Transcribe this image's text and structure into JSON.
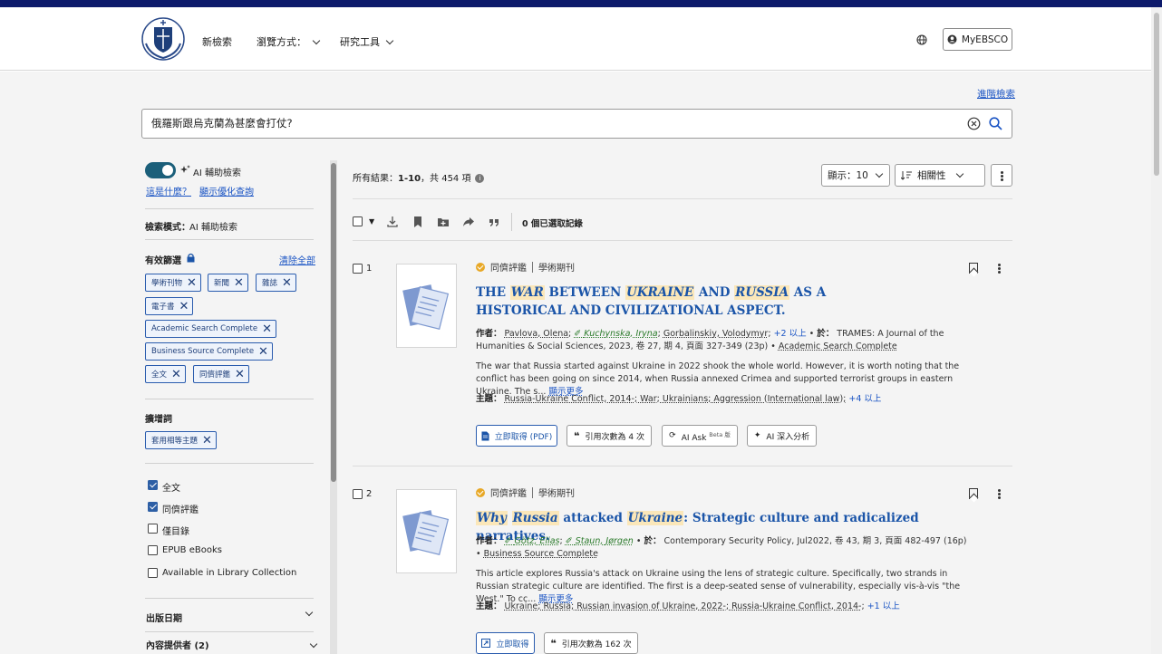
{
  "header": {
    "nav": [
      {
        "label": "新檢索"
      },
      {
        "label": "瀏覽方式："
      },
      {
        "label": "研究工具"
      }
    ],
    "myebsco": "MyEBSCO"
  },
  "search": {
    "advanced_link": "進階檢索",
    "query": "俄羅斯跟烏克蘭為甚麼會打仗?"
  },
  "sidebar": {
    "ai_label": "AI 輔助檢索",
    "what_is": "這是什麼？",
    "show_optimized": "顯示優化查詢",
    "mode_label": "檢索模式：",
    "mode_value": "AI 輔助檢索",
    "active_filters": "有效篩選",
    "clear_all": "清除全部",
    "filters": [
      "學術刊物",
      "新聞",
      "雜誌",
      "電子書",
      "Academic Search Complete",
      "Business Source Complete",
      "全文",
      "同儕評鑑"
    ],
    "expanders_title": "擴增詞",
    "expander_chip": "套用相等主題",
    "limiters": [
      {
        "label": "全文",
        "checked": true
      },
      {
        "label": "同儕評鑑",
        "checked": true
      },
      {
        "label": "僅目錄",
        "checked": false
      },
      {
        "label": "EPUB eBooks",
        "checked": false
      },
      {
        "label": "Available in Library Collection",
        "checked": false
      }
    ],
    "pub_date": "出版日期",
    "providers": "內容提供者 (2)"
  },
  "results": {
    "summary_prefix": "所有結果：",
    "summary_range": "1-10",
    "summary_suffix": "，共 454 項",
    "display_select": "顯示：10",
    "sort_select": "相關性",
    "selected_count": "0 個已選取記錄"
  },
  "records": [
    {
      "num": "1",
      "peer_review": "同儕評鑑",
      "type": "學術期刊",
      "title_parts": [
        {
          "t": "THE ",
          "h": false
        },
        {
          "t": "WAR",
          "h": true
        },
        {
          "t": " BETWEEN ",
          "h": false
        },
        {
          "t": "UKRAINE",
          "h": true
        },
        {
          "t": " AND ",
          "h": false
        },
        {
          "t": "RUSSIA",
          "h": true
        },
        {
          "t": " AS A HISTORICAL AND CIVILIZATIONAL ASPECT.",
          "h": false
        }
      ],
      "authors_label": "作者：",
      "author1": "Pavlova, Olena",
      "author2": "Kuchynska, Iryna",
      "author3": "Gorbalinskiy, Volodymyr",
      "more_authors": "+2 以上",
      "in_label": "於：",
      "source": "TRAMES: A Journal of the Humanities & Social Sciences, 2023, 卷 27, 期 4, 頁面 327-349 (23p) •",
      "database": "Academic Search Complete",
      "abstract": "The war that Russia started against Ukraine in 2022 shook the whole world. However, it is worth noting that the conflict has been going on since 2014, when Russia annexed Crimea and supported terrorist groups in eastern Ukraine. The s...",
      "show_more": "顯示更多",
      "subjects_label": "主題：",
      "subjects": "Russia-Ukraine Conflict, 2014-; War; Ukrainians; Aggression (International law);",
      "more_subjects": "+4 以上",
      "btn_pdf": "立即取得 (PDF)",
      "btn_cite": "引用次數為 4 次",
      "btn_ask": "AI Ask",
      "btn_ask_sup": "Beta 版",
      "btn_deep": "AI 深入分析"
    },
    {
      "num": "2",
      "peer_review": "同儕評鑑",
      "type": "學術期刊",
      "title_parts": [
        {
          "t": "Why",
          "h": true
        },
        {
          "t": " ",
          "h": false
        },
        {
          "t": "Russia",
          "h": true
        },
        {
          "t": " attacked ",
          "h": false
        },
        {
          "t": "Ukraine",
          "h": true
        },
        {
          "t": ": Strategic culture and radicalized narratives.",
          "h": false
        }
      ],
      "authors_label": "作者：",
      "author1": "Götz, Elias",
      "author2": "Staun, Jørgen",
      "in_label": "於：",
      "source": "Contemporary Security Policy, Jul2022, 卷 43, 期 3, 頁面 482-497 (16p) •",
      "database": "Business Source Complete",
      "abstract": "This article explores Russia's attack on Ukraine using the lens of strategic culture. Specifically, two strands in Russian strategic culture are identified. The first is a deep-seated sense of vulnerability, especially vis-à-vis \"the West.\" To cc...",
      "show_more": "顯示更多",
      "subjects_label": "主題：",
      "subjects": "Ukraine; Russia; Russian invasion of Ukraine, 2022-; Russia-Ukraine Conflict, 2014-;",
      "more_subjects": "+1 以上",
      "btn_get": "立即取得",
      "btn_cite": "引用次數為 162 次"
    }
  ]
}
